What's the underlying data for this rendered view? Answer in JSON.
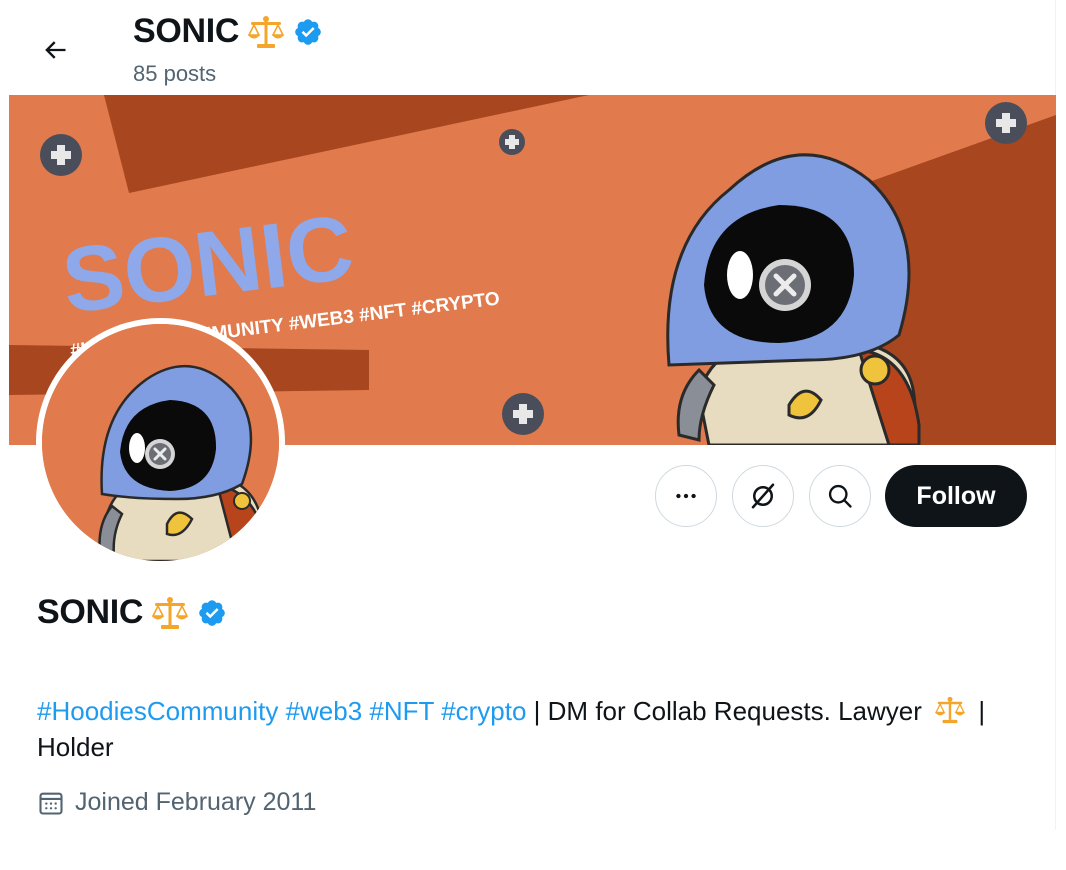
{
  "header": {
    "title": "SONIC",
    "posts": "85 posts"
  },
  "banner": {
    "headline": "SONIC",
    "tagline": "#HOODIESCOMMUNITY #WEB3 #NFT #CRYPTO"
  },
  "actions": {
    "more_icon": "more-icon",
    "grok_icon": "grok-icon",
    "search_icon": "search-icon",
    "follow_label": "Follow"
  },
  "profile": {
    "name": "SONIC",
    "bio_tags": [
      "#HoodiesCommunity",
      "#web3",
      "#NFT",
      "#crypto"
    ],
    "bio_text": " | DM for Collab Requests. Lawyer ",
    "bio_tail": " | Holder",
    "joined": "Joined February 2011"
  },
  "colors": {
    "accent": "#1d9bf0",
    "follow_bg": "#0f1419",
    "banner_bg": "#e17a4c",
    "verified": "#1d9bf0"
  }
}
